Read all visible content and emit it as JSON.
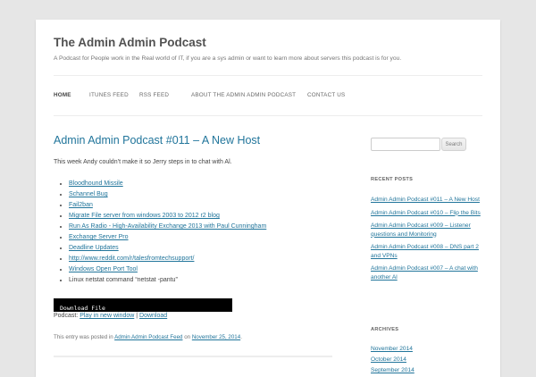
{
  "site": {
    "title": "The Admin Admin Podcast",
    "description": "A Podcast for People work in the Real world of IT, if you are a sys admin or want to learn more about servers this podcast is for you."
  },
  "nav": {
    "items": [
      {
        "label": "HOME",
        "active": true
      },
      {
        "label": "ITUNES FEED",
        "active": false
      },
      {
        "label": "RSS FEED",
        "active": false
      },
      {
        "label": "ABOUT THE ADMIN ADMIN PODCAST",
        "active": false
      },
      {
        "label": "CONTACT US",
        "active": false
      }
    ]
  },
  "post": {
    "title": "Admin Admin Podcast #011 – A New Host",
    "intro": "This week Andy couldn’t make it so Jerry steps in to chat with Al.",
    "links": [
      "Bloodhound Missile",
      "Schannel Bug",
      "Fail2ban",
      "Migrate File server from windows 2003 to 2012 r2 blog",
      "Run As Radio - High-Availability Exchange 2013 with Paul Cunningham",
      "Exchange Server Pro",
      "Deadline Updates",
      "http://www.reddit.com/r/talesfromtechsupport/",
      "Windows Open Port Tool"
    ],
    "last_item": "Linux netstat command “netstat -pantu”",
    "player_label": "Download File",
    "podcast_prefix": "Podcast:",
    "play_link": "Play in new window",
    "separator": "|",
    "download_link": "Download",
    "meta_prefix": "This entry was posted in",
    "category": "Admin Admin Podcast Feed",
    "meta_on": "on",
    "date": "November 25, 2014",
    "meta_end": "."
  },
  "sidebar": {
    "search_button": "Search",
    "recent_title": "RECENT POSTS",
    "recent_posts": [
      "Admin Admin Podcast #011 – A New Host",
      "Admin Admin Podcast #010 – Flip the Bits",
      "Admin Admin Podcast #009 – Listener questions and Monitoring",
      "Admin Admin Podcast #008 – DNS part 2 and VPNs",
      "Admin Admin Podcast #007 – A chat with another Al"
    ],
    "archives_title": "ARCHIVES",
    "archives": [
      "November 2014",
      "October 2014",
      "September 2014"
    ]
  },
  "colors": {
    "link": "#21759b",
    "text": "#444444",
    "background": "#e6e6e6",
    "page": "#ffffff"
  }
}
